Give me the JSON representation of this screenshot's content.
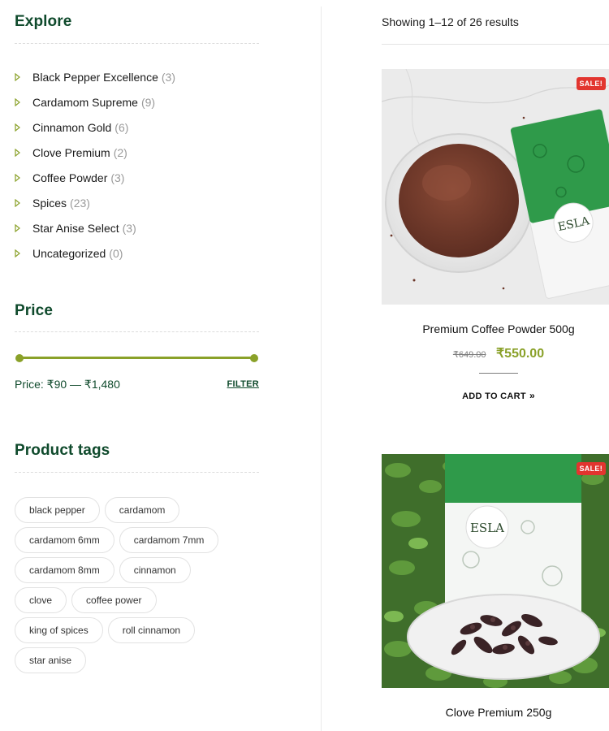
{
  "sidebar": {
    "categories": {
      "title": "Explore",
      "items": [
        {
          "label": "Black Pepper Excellence",
          "count": "(3)"
        },
        {
          "label": "Cardamom Supreme",
          "count": "(9)"
        },
        {
          "label": "Cinnamon Gold",
          "count": "(6)"
        },
        {
          "label": "Clove Premium",
          "count": "(2)"
        },
        {
          "label": "Coffee Powder",
          "count": "(3)"
        },
        {
          "label": "Spices",
          "count": "(23)"
        },
        {
          "label": "Star Anise Select",
          "count": "(3)"
        },
        {
          "label": "Uncategorized",
          "count": "(0)"
        }
      ]
    },
    "price_filter": {
      "title": "Price",
      "price_text": "Price: ₹90 — ₹1,480",
      "filter_label": "FILTER",
      "range_fraction": [
        0,
        1
      ]
    },
    "tags": {
      "title": "Product tags",
      "rows": [
        [
          "black pepper",
          "cardamom"
        ],
        [
          "cardamom 6mm",
          "cardamom 7mm"
        ],
        [
          "cardamom 8mm",
          "cinnamon"
        ],
        [
          "clove",
          "coffee power"
        ],
        [
          "king of spices",
          "roll cinnamon"
        ],
        [
          "star anise"
        ]
      ]
    }
  },
  "main": {
    "results_text": "Showing 1–12 of 26 results",
    "products": [
      {
        "badge": "SALE!",
        "title": "Premium Coffee Powder 500g",
        "old_price": "₹649.00",
        "new_price": "₹550.00",
        "add_to_cart": "ADD TO CART",
        "cart_icon": "chevron-right-icon"
      },
      {
        "badge": "SALE!",
        "title": "Clove Premium 250g"
      }
    ]
  },
  "colors": {
    "brand_green": "#0f4a2c",
    "accent_olive": "#8aa129",
    "sale_red": "#e2352f"
  }
}
